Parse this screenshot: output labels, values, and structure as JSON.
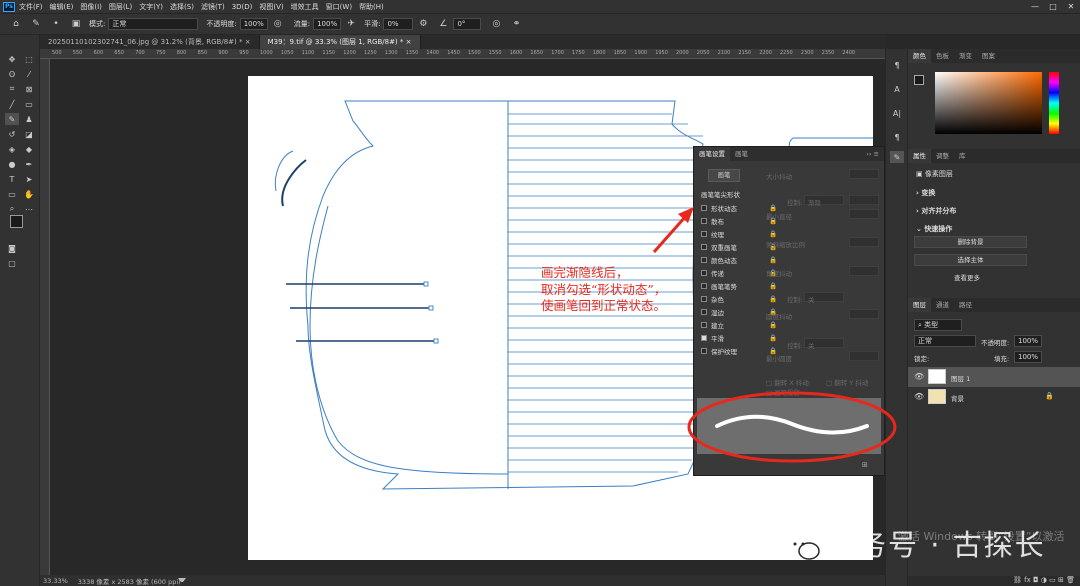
{
  "app": {
    "logo": "Ps"
  },
  "menu": [
    "文件(F)",
    "编辑(E)",
    "图像(I)",
    "图层(L)",
    "文字(Y)",
    "选择(S)",
    "滤镜(T)",
    "3D(D)",
    "视图(V)",
    "增效工具",
    "窗口(W)",
    "帮助(H)"
  ],
  "window_controls": {
    "minimize": "—",
    "maximize": "□",
    "close": "✕"
  },
  "options": {
    "mode_label": "模式:",
    "mode_value": "正常",
    "opacity_label": "不透明度:",
    "opacity_value": "100%",
    "flow_label": "流量:",
    "flow_value": "100%",
    "smooth_label": "平滑:",
    "smooth_value": "0%",
    "angle_value": "0°"
  },
  "tabs": [
    {
      "label": "20250110102302741_06.jpg @ 31.2% (背景, RGB/8#) *",
      "close": "×"
    },
    {
      "label": "M39：9.tif @ 33.3% (图层 1, RGB/8#) *",
      "close": "×"
    }
  ],
  "ruler_ticks": [
    "500",
    "550",
    "600",
    "650",
    "700",
    "750",
    "800",
    "850",
    "900",
    "950",
    "1000",
    "1050",
    "1100",
    "1150",
    "1200",
    "1250",
    "1300",
    "1350",
    "1400",
    "1450",
    "1500",
    "1550",
    "1600",
    "1650",
    "1700",
    "1750",
    "1800",
    "1850",
    "1900",
    "1950",
    "2000",
    "2050",
    "2100",
    "2150",
    "2200",
    "2250",
    "2300",
    "2350",
    "2400"
  ],
  "status": {
    "zoom": "33.33%",
    "doc_size": "3338 像素 x 2583 像素 (600 ppi)"
  },
  "color_panel": {
    "tabs": [
      "颜色",
      "色板",
      "渐变",
      "图案"
    ]
  },
  "properties_panel": {
    "tabs": [
      "属性",
      "调整",
      "库"
    ],
    "layer_type": "像素图层",
    "sections": [
      "变换",
      "对齐并分布",
      "快速操作"
    ],
    "buttons": [
      "删除背景",
      "选择主体"
    ],
    "more": "查看更多"
  },
  "layers_panel": {
    "tabs": [
      "图层",
      "通道",
      "路径"
    ],
    "filter": "类型",
    "blend": "正常",
    "opacity_label": "不透明度:",
    "opacity_value": "100%",
    "lock_label": "锁定:",
    "fill_label": "填充:",
    "fill_value": "100%",
    "layers": [
      {
        "name": "图层 1"
      },
      {
        "name": "背景"
      }
    ]
  },
  "brush_settings": {
    "tabs": [
      "画笔设置",
      "画笔"
    ],
    "preset_button": "画笔",
    "tip_shape": "画笔笔尖形状",
    "items": [
      {
        "label": "形状动态",
        "checked": false,
        "lock": "🔒"
      },
      {
        "label": "散布",
        "checked": false,
        "lock": "🔒"
      },
      {
        "label": "纹理",
        "checked": false,
        "lock": "🔒"
      },
      {
        "label": "双重画笔",
        "checked": false,
        "lock": "🔒"
      },
      {
        "label": "颜色动态",
        "checked": false,
        "lock": "🔒"
      },
      {
        "label": "传递",
        "checked": false,
        "lock": "🔒"
      },
      {
        "label": "画笔笔势",
        "checked": false,
        "lock": "🔒"
      },
      {
        "label": "杂色",
        "checked": false,
        "lock": "🔒"
      },
      {
        "label": "湿边",
        "checked": false,
        "lock": "🔒"
      },
      {
        "label": "建立",
        "checked": false,
        "lock": "🔒"
      },
      {
        "label": "平滑",
        "checked": true,
        "lock": "🔒"
      },
      {
        "label": "保护纹理",
        "checked": false,
        "lock": "🔒"
      }
    ],
    "dim_labels": {
      "size_jitter": "大小抖动",
      "control1": "控制:",
      "fade": "渐隐",
      "min_diameter": "最小直径",
      "tilt_scale": "倾斜缩放比例",
      "angle_jitter": "角度抖动",
      "control2": "控制:",
      "off1": "关",
      "roundness_jitter": "圆度抖动",
      "control3": "控制:",
      "off2": "关",
      "min_roundness": "最小圆度",
      "flip_x": "翻转 X 抖动",
      "flip_y": "翻转 Y 抖动",
      "projection": "画笔投影"
    }
  },
  "annotation": {
    "lines": [
      "画完渐隐线后，",
      "取消勾选“形状动态”，",
      "使画笔回到正常状态。"
    ],
    "color": "#e8281c"
  },
  "watermark": {
    "text": "服务号 · 古探长",
    "faded": "激活 Windows 转到“设置”以激活"
  },
  "colors": {
    "accent": "#31a8ff",
    "drawing_line": "#3a7fc4",
    "annotation": "#e8281c",
    "fg_color": "#1a1a1a",
    "bg_color": "#ffffff"
  }
}
